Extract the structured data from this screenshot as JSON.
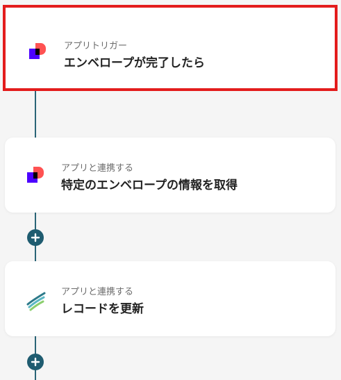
{
  "steps": [
    {
      "subtitle": "アプリトリガー",
      "title": "エンベロープが完了したら",
      "icon": "docusign-icon"
    },
    {
      "subtitle": "アプリと連携する",
      "title": "特定のエンベロープの情報を取得",
      "icon": "docusign-icon"
    },
    {
      "subtitle": "アプリと連携する",
      "title": "レコードを更新",
      "icon": "kintone-feather-icon"
    }
  ],
  "colors": {
    "highlight_border": "#e31c1c",
    "connector": "#2a6577",
    "add_button": "#1f5c70"
  }
}
